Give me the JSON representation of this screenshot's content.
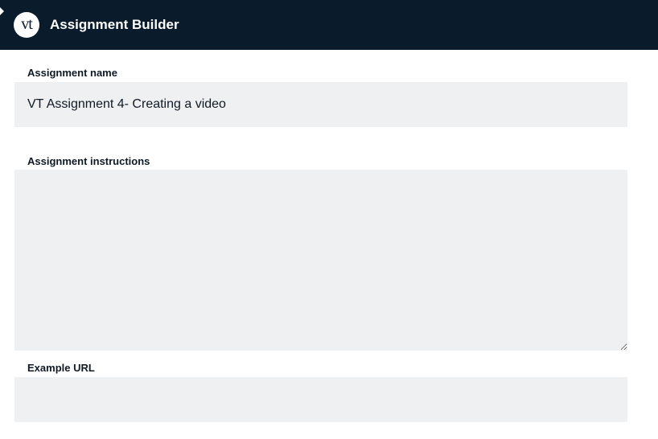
{
  "header": {
    "logo_text": "vt",
    "title": "Assignment Builder",
    "background_color": "#0a1c2c"
  },
  "form": {
    "assignment_name": {
      "label": "Assignment name",
      "value": "VT Assignment 4- Creating a video"
    },
    "assignment_instructions": {
      "label": "Assignment instructions",
      "value": ""
    },
    "example_url": {
      "label": "Example URL",
      "value": ""
    },
    "field_background_color": "#eff0f2"
  }
}
